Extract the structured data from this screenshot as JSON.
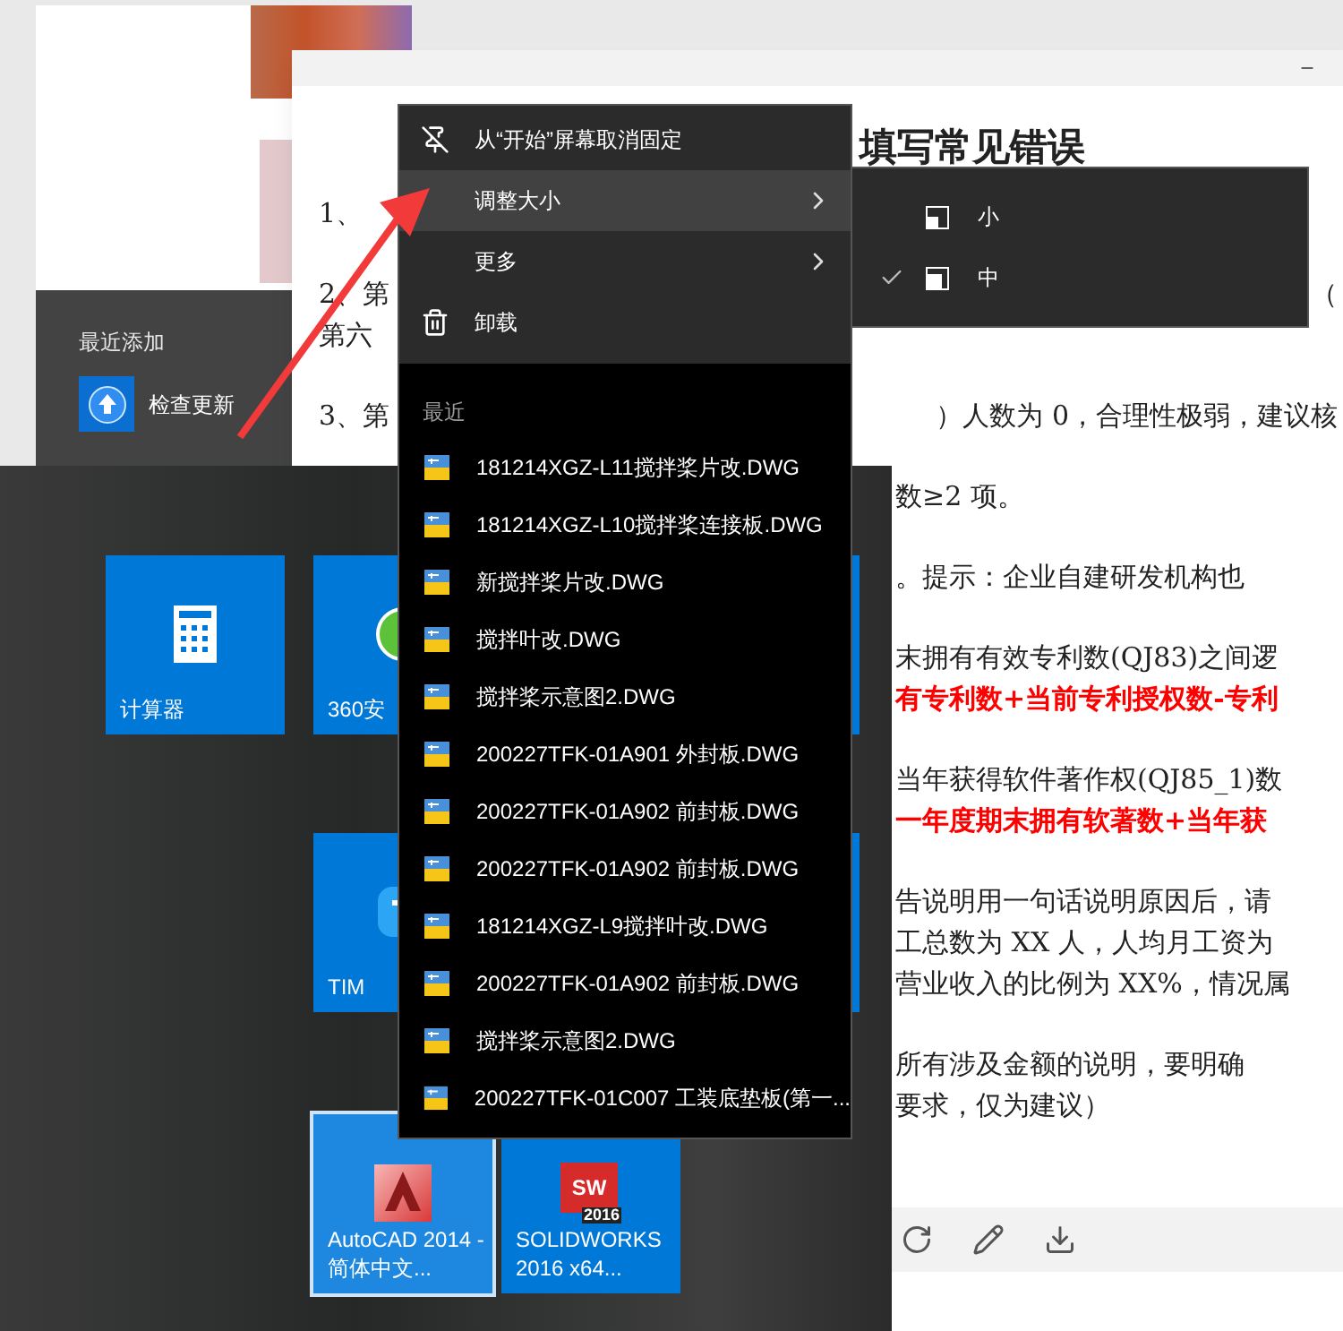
{
  "start_menu": {
    "section_title": "最近添加",
    "recent_apps": [
      {
        "label": "检查更新",
        "kind": "update"
      }
    ]
  },
  "tiles": [
    {
      "label": "计算器",
      "kind": "calculator",
      "selected": false
    },
    {
      "label": "360安",
      "kind": "security",
      "selected": false
    },
    {
      "label": "TIM",
      "kind": "tim",
      "selected": false
    },
    {
      "label": "AutoCAD 2014 - 简体中文...",
      "kind": "autocad",
      "selected": true
    },
    {
      "label": "SOLIDWORKS 2016 x64...",
      "kind": "solidworks",
      "selected": false,
      "icon_text": "SW",
      "icon_subtext": "2016"
    }
  ],
  "document": {
    "heading": "填写常见错误",
    "paragraphs": [
      [
        {
          "left": "1、"
        }
      ],
      [
        {
          "left": "2、第",
          "right": "（"
        },
        {
          "left": "第六"
        }
      ],
      [
        {
          "left": "3、第",
          "right": "）人数为 0，合理性极弱，建议核"
        }
      ],
      [
        {
          "right": "数≥2 项。"
        }
      ],
      [
        {
          "right": "。提示：企业自建研发机构也"
        }
      ],
      [
        {
          "right": "末拥有有效专利数(QJ83)之间逻"
        },
        {
          "right": "有专利数+当前专利授权数-专利",
          "emphasis": true
        }
      ],
      [
        {
          "right": "当年获得软件著作权(QJ85_1)数"
        },
        {
          "right": "一年度期末拥有软著数+当年获",
          "emphasis": true
        }
      ],
      [
        {
          "right": "告说明用一句话说明原因后，请"
        },
        {
          "right": "工总数为 XX 人，人均月工资为"
        },
        {
          "right": "营业收入的比例为 XX%，情况属"
        }
      ],
      [
        {
          "right": "所有涉及金额的说明，要明确"
        },
        {
          "right": "要求，仅为建议）"
        }
      ]
    ]
  },
  "context_menu": {
    "items": [
      {
        "label": "从“开始”屏幕取消固定",
        "kind": "unpin",
        "has_submenu": false,
        "selected": false
      },
      {
        "label": "调整大小",
        "kind": "plain",
        "has_submenu": true,
        "selected": true
      },
      {
        "label": "更多",
        "kind": "plain",
        "has_submenu": true,
        "selected": false
      },
      {
        "label": "卸载",
        "kind": "uninstall",
        "has_submenu": false,
        "selected": false
      }
    ],
    "recent_heading": "最近",
    "recent_files": [
      "181214XGZ-L11搅拌桨片改.DWG",
      "181214XGZ-L10搅拌桨连接板.DWG",
      "新搅拌桨片改.DWG",
      "搅拌叶改.DWG",
      "搅拌桨示意图2.DWG",
      "200227TFK-01A901 外封板.DWG",
      "200227TFK-01A902 前封板.DWG",
      "200227TFK-01A902 前封板.DWG",
      "181214XGZ-L9搅拌叶改.DWG",
      "200227TFK-01A902 前封板.DWG",
      "搅拌桨示意图2.DWG",
      "200227TFK-01C007 工装底垫板(第一..."
    ]
  },
  "size_submenu": [
    {
      "label": "小",
      "kind": "small",
      "checked": false
    },
    {
      "label": "中",
      "kind": "medium",
      "checked": true
    }
  ]
}
